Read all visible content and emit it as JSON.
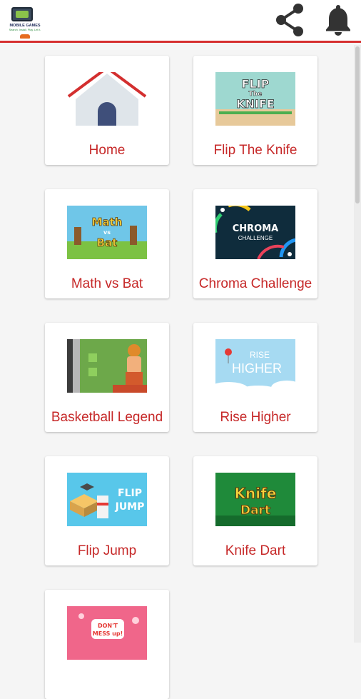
{
  "header": {
    "logo": {
      "line1": "MOBILE GAMES",
      "line2": "Search. Install. Play. Let it."
    },
    "share_icon": "share-icon",
    "bell_icon": "bell-icon",
    "accent_color": "#d62f2f"
  },
  "grid": {
    "items": [
      {
        "label": "Home",
        "icon": "home-icon"
      },
      {
        "label": "Flip The Knife",
        "thumb_text": [
          "FLIP",
          "The",
          "KNIFE"
        ]
      },
      {
        "label": "Math vs Bat",
        "thumb_text": [
          "Math",
          "vs",
          "Bat"
        ]
      },
      {
        "label": "Chroma Challenge",
        "thumb_text": [
          "CHROMA",
          "CHALLENGE"
        ]
      },
      {
        "label": "Basketball Legend",
        "thumb_text": []
      },
      {
        "label": "Rise Higher",
        "thumb_text": [
          "RISE",
          "HIGHER"
        ]
      },
      {
        "label": "Flip Jump",
        "thumb_text": [
          "FLIP",
          "JUMP"
        ]
      },
      {
        "label": "Knife Dart",
        "thumb_text": [
          "Knife",
          "Dart"
        ]
      },
      {
        "label": "",
        "thumb_text": [
          "DON'T",
          "MESS up!"
        ]
      }
    ]
  },
  "colors": {
    "label": "#c62828",
    "background": "#f5f5f5"
  }
}
